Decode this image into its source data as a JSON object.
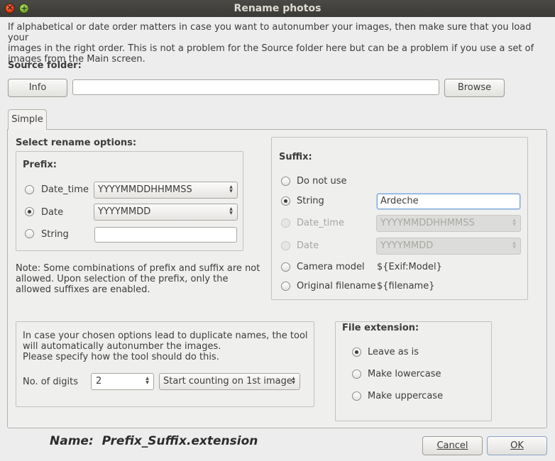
{
  "window": {
    "title": "Rename photos"
  },
  "intro": {
    "text": "If alphabetical or date order matters in case you want to autonumber your images, then make sure that you load your\nimages in the right order. This is not a problem for the Source folder here but can be a problem if you use a set of\nimages from the Main screen."
  },
  "source": {
    "label": "Source folder:",
    "info_button": "Info",
    "path_value": "",
    "browse_button": "Browse"
  },
  "tabs": [
    {
      "label": "Simple",
      "selected": true
    }
  ],
  "rename_options": {
    "heading": "Select rename options:"
  },
  "prefix": {
    "heading": "Prefix:",
    "options": [
      {
        "label": "Date_time",
        "selected": false,
        "combo_value": "YYYYMMDDHHMMSS"
      },
      {
        "label": "Date",
        "selected": true,
        "combo_value": "YYYYMMDD"
      },
      {
        "label": "String",
        "selected": false,
        "input_value": ""
      }
    ]
  },
  "note": {
    "text": "Note: Some combinations of prefix and suffix are not\nallowed. Upon selection of the prefix, only the\nallowed suffixes are enabled."
  },
  "suffix": {
    "heading": "Suffix:",
    "options": [
      {
        "label": "Do not use",
        "selected": false
      },
      {
        "label": "String",
        "selected": true,
        "input_value": "Ardeche"
      },
      {
        "label": "Date_time",
        "selected": false,
        "disabled": true,
        "combo_value": "YYYYMMDDHHMMSS"
      },
      {
        "label": "Date",
        "selected": false,
        "disabled": true,
        "combo_value": "YYYYMMDD"
      },
      {
        "label": "Camera model",
        "selected": false,
        "value_text": "${Exif:Model}"
      },
      {
        "label": "Original filename",
        "selected": false,
        "value_text": "${filename}"
      }
    ]
  },
  "duplicates": {
    "text": "In case your chosen options lead to duplicate names, the tool\nwill automatically autonumber the images.\nPlease specify how the tool should do this.",
    "digits_label": "No. of digits",
    "digits_value": "2",
    "counting_value": "Start counting on 1st image"
  },
  "file_extension": {
    "heading": "File extension:",
    "options": [
      {
        "label": "Leave as is",
        "selected": true
      },
      {
        "label": "Make lowercase",
        "selected": false
      },
      {
        "label": "Make uppercase",
        "selected": false
      }
    ]
  },
  "footer": {
    "name_prefix": "Name:",
    "name_pattern": "Prefix_Suffix.extension",
    "cancel_button": "Cancel",
    "ok_button": "OK"
  }
}
